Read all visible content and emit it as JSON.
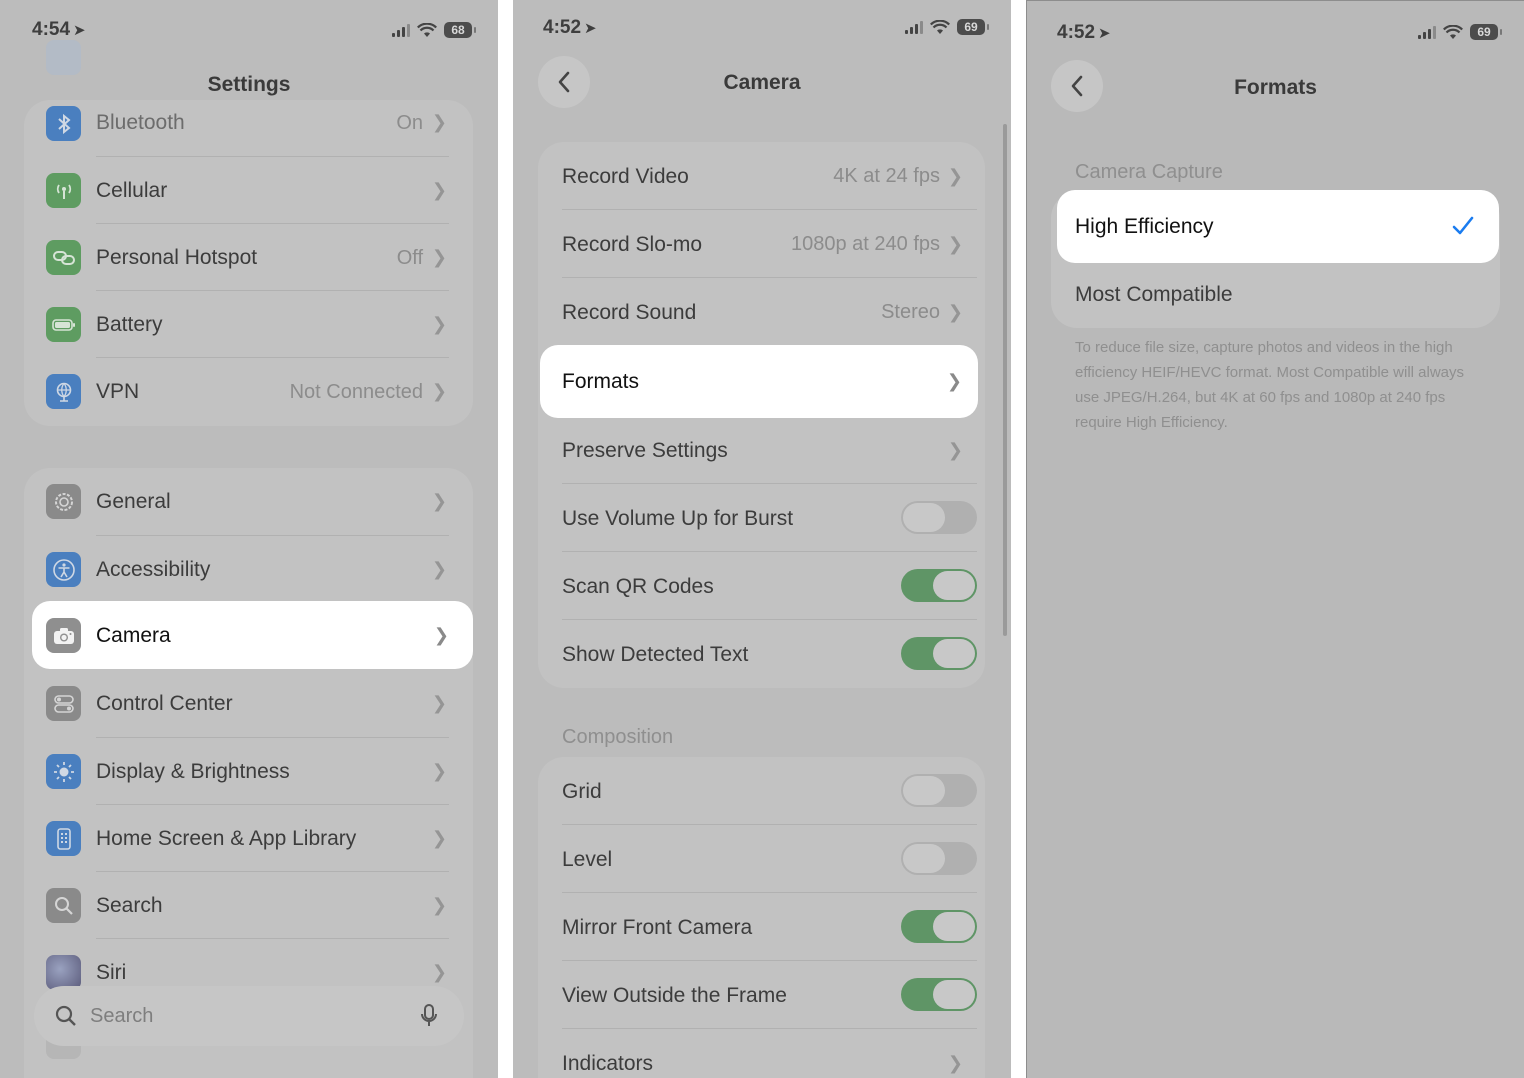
{
  "colors": {
    "highlight": "#ffffff",
    "checkmark": "#1a7cf0",
    "toggle_on": "#5f9566",
    "toggle_off": "#b0b0b0"
  },
  "panel1": {
    "time": "4:54",
    "battery": "68",
    "title": "Settings",
    "group1": [
      {
        "label": "Bluetooth",
        "value": "On",
        "icon": "bluetooth-icon",
        "color": "#4a7fbf"
      },
      {
        "label": "Cellular",
        "value": "",
        "icon": "cellular-antenna-icon",
        "color": "#5e9c61"
      },
      {
        "label": "Personal Hotspot",
        "value": "Off",
        "icon": "hotspot-link-icon",
        "color": "#5e9c61"
      },
      {
        "label": "Battery",
        "value": "",
        "icon": "battery-icon",
        "color": "#5e9c61"
      },
      {
        "label": "VPN",
        "value": "Not Connected",
        "icon": "globe-icon",
        "color": "#4a7fbf"
      }
    ],
    "group2": [
      {
        "label": "General",
        "icon": "gear-icon",
        "color": "#8a8a8a"
      },
      {
        "label": "Accessibility",
        "icon": "accessibility-icon",
        "color": "#4a7fbf"
      },
      {
        "label": "Camera",
        "icon": "camera-icon",
        "color": "#8f8f8f",
        "highlighted": true
      },
      {
        "label": "Control Center",
        "icon": "control-center-icon",
        "color": "#8a8a8a"
      },
      {
        "label": "Display & Brightness",
        "icon": "sun-icon",
        "color": "#4a7fbf"
      },
      {
        "label": "Home Screen & App Library",
        "icon": "home-screen-icon",
        "color": "#4a7fbf"
      },
      {
        "label": "Search",
        "icon": "search-icon",
        "color": "#8a8a8a"
      },
      {
        "label": "Siri",
        "icon": "siri-icon",
        "color": "#6a6a8a"
      }
    ],
    "search_placeholder": "Search"
  },
  "panel2": {
    "time": "4:52",
    "battery": "69",
    "title": "Camera",
    "rows": [
      {
        "label": "Record Video",
        "value": "4K at 24 fps",
        "type": "nav"
      },
      {
        "label": "Record Slo-mo",
        "value": "1080p at 240 fps",
        "type": "nav"
      },
      {
        "label": "Record Sound",
        "value": "Stereo",
        "type": "nav"
      },
      {
        "label": "Formats",
        "value": "",
        "type": "nav",
        "highlighted": true
      },
      {
        "label": "Preserve Settings",
        "value": "",
        "type": "nav"
      },
      {
        "label": "Use Volume Up for Burst",
        "type": "toggle",
        "on": false
      },
      {
        "label": "Scan QR Codes",
        "type": "toggle",
        "on": true
      },
      {
        "label": "Show Detected Text",
        "type": "toggle",
        "on": true
      }
    ],
    "composition_header": "Composition",
    "composition_rows": [
      {
        "label": "Grid",
        "type": "toggle",
        "on": false
      },
      {
        "label": "Level",
        "type": "toggle",
        "on": false
      },
      {
        "label": "Mirror Front Camera",
        "type": "toggle",
        "on": true
      },
      {
        "label": "View Outside the Frame",
        "type": "toggle",
        "on": true
      },
      {
        "label": "Indicators",
        "type": "nav"
      }
    ]
  },
  "panel3": {
    "time": "4:52",
    "battery": "69",
    "title": "Formats",
    "section_header": "Camera Capture",
    "options": [
      {
        "label": "High Efficiency",
        "selected": true
      },
      {
        "label": "Most Compatible",
        "selected": false
      }
    ],
    "footnote": "To reduce file size, capture photos and videos in the high efficiency HEIF/HEVC format. Most Compatible will always use JPEG/H.264, but 4K at 60 fps and 1080p at 240 fps require High Efficiency."
  }
}
